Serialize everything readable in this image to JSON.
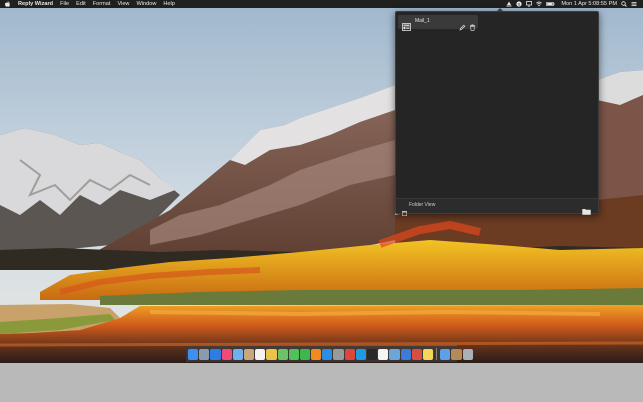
{
  "menubar": {
    "app_name": "Reply Wizard",
    "menus": [
      "File",
      "Edit",
      "Format",
      "View",
      "Window",
      "Help"
    ],
    "clock": "Mon 1 Apr  5:08:55 PM"
  },
  "popover": {
    "mail_item_label": "Mail_1",
    "footer_label": "Folder View"
  },
  "dock": {
    "apps": [
      {
        "name": "Finder",
        "color": "#3f8ff0"
      },
      {
        "name": "Launchpad",
        "color": "#8a9bb0"
      },
      {
        "name": "Safari",
        "color": "#2f7de0"
      },
      {
        "name": "iTunes",
        "color": "#f04a78"
      },
      {
        "name": "Mail",
        "color": "#6fb0f0"
      },
      {
        "name": "Contacts",
        "color": "#c9a77a"
      },
      {
        "name": "Calendar",
        "color": "#f2f2f2"
      },
      {
        "name": "Photos",
        "color": "#e9c34a"
      },
      {
        "name": "Maps",
        "color": "#6cc26a"
      },
      {
        "name": "Messages",
        "color": "#4fc25a"
      },
      {
        "name": "FaceTime",
        "color": "#3eb84e"
      },
      {
        "name": "iBooks",
        "color": "#f28a1d"
      },
      {
        "name": "App Store",
        "color": "#2a8ee8"
      },
      {
        "name": "System Preferences",
        "color": "#9a9a9a"
      },
      {
        "name": "Chrome",
        "color": "#e0453a"
      },
      {
        "name": "Skype",
        "color": "#1f9be0"
      },
      {
        "name": "Terminal",
        "color": "#2a2a2a"
      },
      {
        "name": "TextEdit",
        "color": "#f5f5f5"
      },
      {
        "name": "Preview",
        "color": "#6aa6d8"
      },
      {
        "name": "Xcode",
        "color": "#3c7bd6"
      },
      {
        "name": "Reply Wizard",
        "color": "#d94d43"
      },
      {
        "name": "Notes",
        "color": "#f4d65a"
      }
    ],
    "docs": [
      {
        "name": "Downloads",
        "color": "#5ea0e6"
      },
      {
        "name": "Photos Stack",
        "color": "#b58a5a"
      },
      {
        "name": "Trash",
        "color": "#a9b0b8"
      }
    ]
  }
}
